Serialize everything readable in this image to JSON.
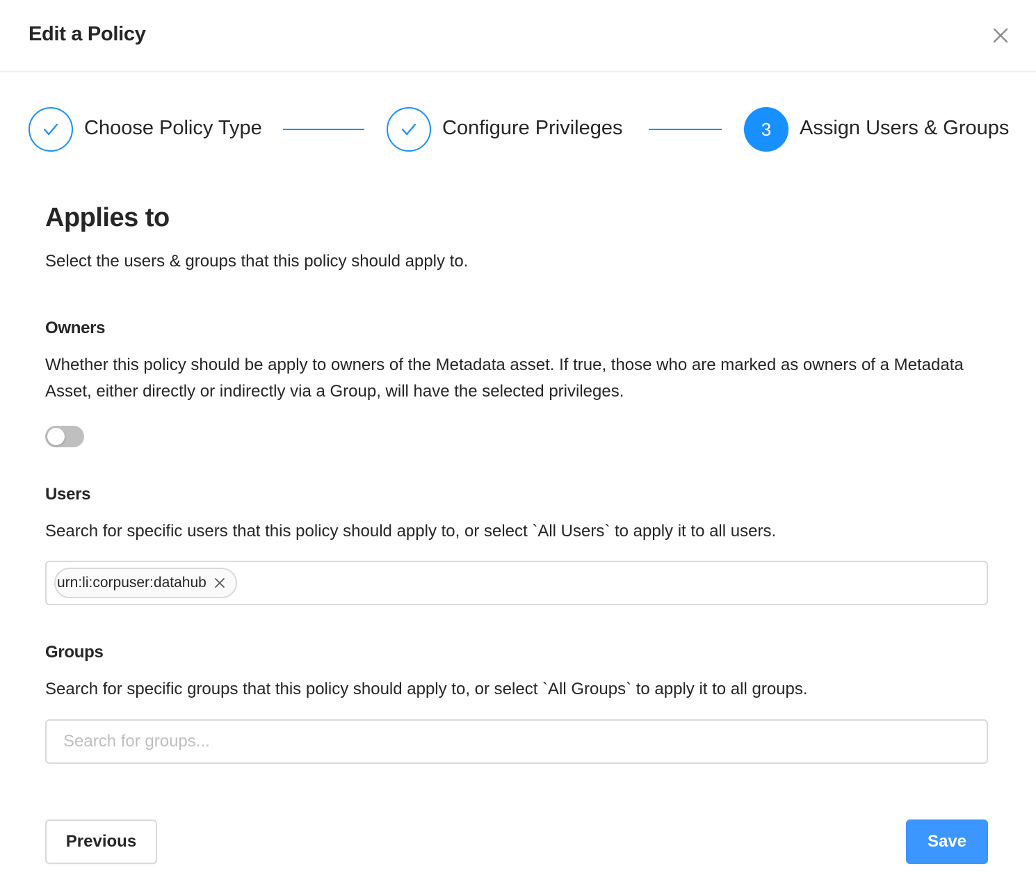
{
  "modal": {
    "title": "Edit a Policy",
    "close_icon": "close-icon"
  },
  "steps": [
    {
      "title": "Choose Policy Type",
      "status": "finish",
      "icon": "check-icon"
    },
    {
      "title": "Configure Privileges",
      "status": "finish",
      "icon": "check-icon"
    },
    {
      "title": "Assign Users & Groups",
      "status": "process",
      "number": "3"
    }
  ],
  "applies_to": {
    "title": "Applies to",
    "description": "Select the users & groups that this policy should apply to."
  },
  "owners": {
    "label": "Owners",
    "description": "Whether this policy should be apply to owners of the Metadata asset. If true, those who are marked as owners of a Metadata Asset, either directly or indirectly via a Group, will have the selected privileges.",
    "toggle_on": false
  },
  "users": {
    "label": "Users",
    "description": "Search for specific users that this policy should apply to, or select `All Users` to apply it to all users.",
    "selected": [
      "urn:li:corpuser:datahub"
    ]
  },
  "groups": {
    "label": "Groups",
    "description": "Search for specific groups that this policy should apply to, or select `All Groups` to apply it to all groups.",
    "placeholder": "Search for groups..."
  },
  "footer": {
    "previous_label": "Previous",
    "save_label": "Save"
  },
  "colors": {
    "primary": "#1890ff",
    "save_button": "#3b96ff",
    "toggle_off": "#bfbfbf"
  }
}
